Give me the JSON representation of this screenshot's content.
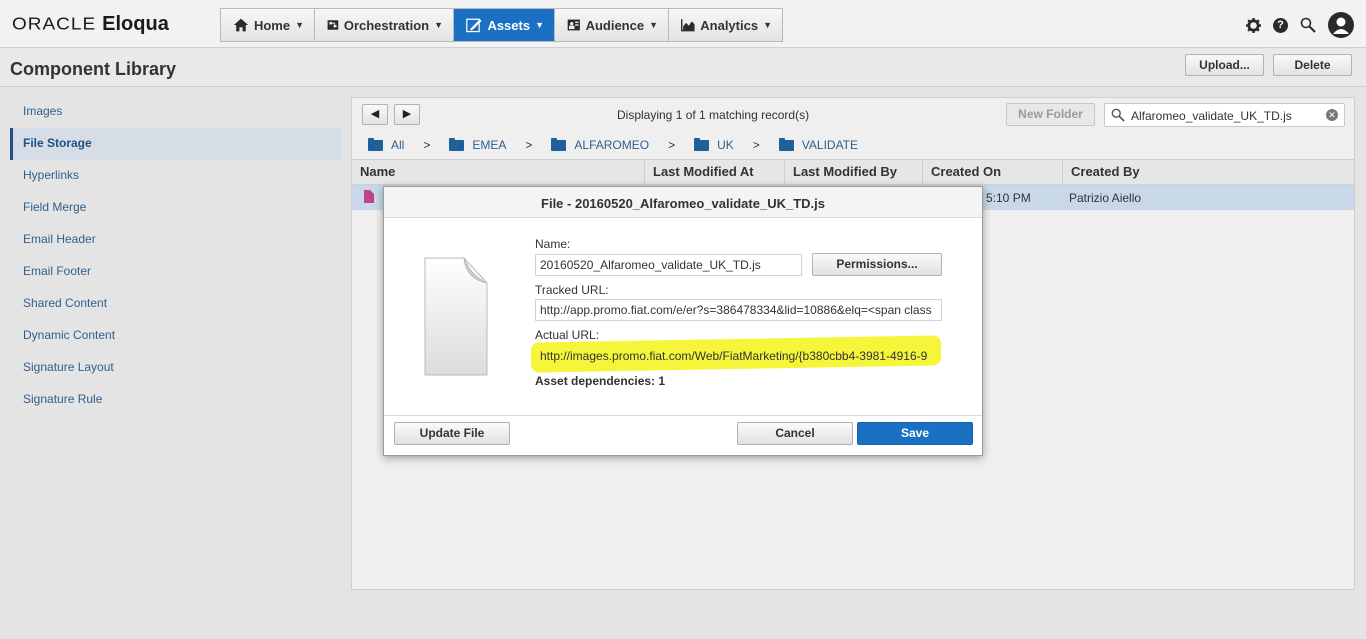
{
  "brand": {
    "oracle": "ORACLE",
    "eloqua": "Eloqua"
  },
  "nav": [
    {
      "label": "Home",
      "icon": "home-icon"
    },
    {
      "label": "Orchestration",
      "icon": "orchestration-icon"
    },
    {
      "label": "Assets",
      "icon": "assets-icon",
      "active": true
    },
    {
      "label": "Audience",
      "icon": "audience-icon"
    },
    {
      "label": "Analytics",
      "icon": "analytics-icon"
    }
  ],
  "header": {
    "title": "Component Library",
    "upload": "Upload...",
    "delete": "Delete"
  },
  "sidebar": {
    "items": [
      {
        "label": "Images"
      },
      {
        "label": "File Storage",
        "active": true
      },
      {
        "label": "Hyperlinks"
      },
      {
        "label": "Field Merge"
      },
      {
        "label": "Email Header"
      },
      {
        "label": "Email Footer"
      },
      {
        "label": "Shared Content"
      },
      {
        "label": "Dynamic Content"
      },
      {
        "label": "Signature Layout"
      },
      {
        "label": "Signature Rule"
      }
    ]
  },
  "toolbar": {
    "prev": "◀",
    "next": "▶",
    "display_text": "Displaying 1 of 1 matching record(s)",
    "new_folder": "New Folder",
    "search_value": "Alfaromeo_validate_UK_TD.js"
  },
  "breadcrumb": [
    "All",
    "EMEA",
    "ALFAROMEO",
    "UK",
    "VALIDATE"
  ],
  "breadcrumb_sep": ">",
  "table": {
    "columns": [
      "Name",
      "Last Modified At",
      "Last Modified By",
      "Created On",
      "Created By"
    ],
    "row": {
      "created_on_partial": "5:10 PM",
      "created_by": "Patrizio Aiello"
    }
  },
  "modal": {
    "title": "File - 20160520_Alfaromeo_validate_UK_TD.js",
    "name_label": "Name:",
    "name_value": "20160520_Alfaromeo_validate_UK_TD.js",
    "permissions": "Permissions...",
    "tracked_label": "Tracked URL:",
    "tracked_value": "http://app.promo.fiat.com/e/er?s=386478334&lid=10886&elq=<span class",
    "actual_label": "Actual URL:",
    "actual_value": "http://images.promo.fiat.com/Web/FiatMarketing/{b380cbb4-3981-4916-9",
    "deps": "Asset dependencies: 1",
    "update_file": "Update File",
    "cancel": "Cancel",
    "save": "Save",
    "highlight_color": "#f5f53a"
  },
  "colors": {
    "accent": "#1a71c4",
    "selected_row": "#c9d8e8"
  }
}
